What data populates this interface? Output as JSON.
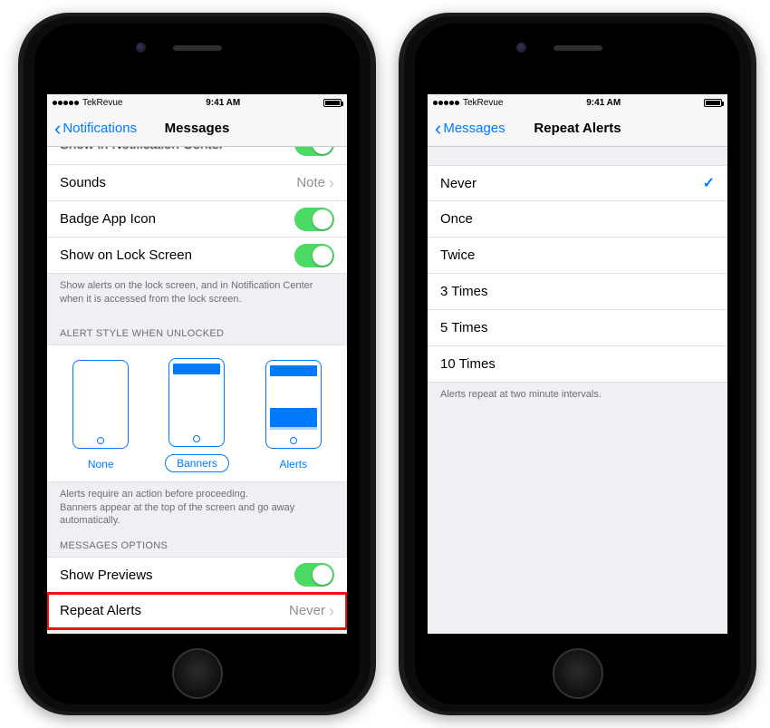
{
  "status": {
    "carrier": "TekRevue",
    "time": "9:41 AM"
  },
  "left": {
    "back": "Notifications",
    "title": "Messages",
    "rows": {
      "sounds": {
        "label": "Sounds",
        "value": "Note"
      },
      "badge": {
        "label": "Badge App Icon"
      },
      "lock": {
        "label": "Show on Lock Screen"
      }
    },
    "lock_footer": "Show alerts on the lock screen, and in Notification Center when it is accessed from the lock screen.",
    "alert_header": "ALERT STYLE WHEN UNLOCKED",
    "styles": {
      "none": "None",
      "banners": "Banners",
      "alerts": "Alerts"
    },
    "alert_footer": "Alerts require an action before proceeding.\nBanners appear at the top of the screen and go away automatically.",
    "options_header": "MESSAGES OPTIONS",
    "previews": {
      "label": "Show Previews"
    },
    "repeat": {
      "label": "Repeat Alerts",
      "value": "Never"
    }
  },
  "right": {
    "back": "Messages",
    "title": "Repeat Alerts",
    "options": [
      "Never",
      "Once",
      "Twice",
      "3 Times",
      "5 Times",
      "10 Times"
    ],
    "selected_index": 0,
    "footer": "Alerts repeat at two minute intervals."
  }
}
